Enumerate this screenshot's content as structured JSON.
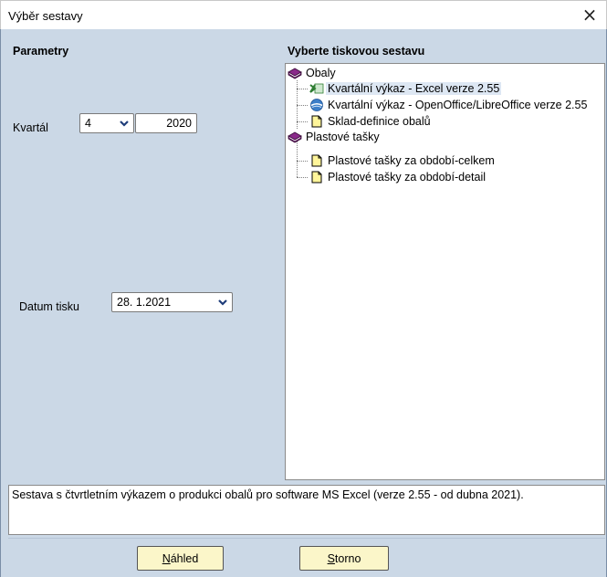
{
  "window": {
    "title": "Výběr sestavy",
    "close_glyph": "×"
  },
  "params": {
    "header": "Parametry",
    "quarter_label": "Kvartál",
    "quarter_value": "4",
    "year_value": "2020",
    "print_date_label": "Datum tisku",
    "print_date_value": "28. 1.2021"
  },
  "reports": {
    "header": "Vyberte tiskovou sestavu",
    "groups": [
      {
        "label": "Obaly",
        "icon": "book-icon",
        "items": [
          {
            "label": "Kvartální výkaz - Excel verze 2.55",
            "icon": "excel-icon",
            "selected": true
          },
          {
            "label": "Kvartální výkaz - OpenOffice/LibreOffice verze 2.55",
            "icon": "openoffice-icon",
            "selected": false
          },
          {
            "label": "Sklad-definice obalů",
            "icon": "document-icon",
            "selected": false
          }
        ]
      },
      {
        "label": "Plastové tašky",
        "icon": "book-icon",
        "items": [
          {
            "label": "Plastové tašky za období-celkem",
            "icon": "document-icon",
            "selected": false
          },
          {
            "label": "Plastové tašky za období-detail",
            "icon": "document-icon",
            "selected": false
          }
        ]
      }
    ]
  },
  "description": "Sestava s čtvrtletním výkazem o produkci obalů pro software MS Excel (verze 2.55 - od dubna 2021).",
  "buttons": {
    "preview_mnemonic": "N",
    "preview_rest": "áhled",
    "cancel_mnemonic": "S",
    "cancel_rest": "torno"
  },
  "colors": {
    "dialog_background": "#cbd8e6",
    "button_background": "#fbf6c9",
    "selection_background": "#dde7f3"
  }
}
